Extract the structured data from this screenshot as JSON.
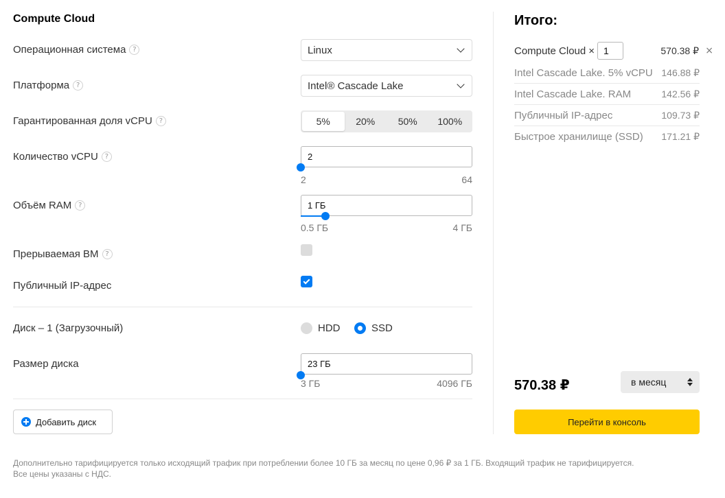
{
  "config": {
    "title": "Compute Cloud",
    "os": {
      "label": "Операционная система",
      "value": "Linux"
    },
    "platform": {
      "label": "Платформа",
      "value": "Intel® Cascade Lake"
    },
    "vcpu_share": {
      "label": "Гарантированная доля vCPU",
      "options": [
        "5%",
        "20%",
        "50%",
        "100%"
      ],
      "selected": "5%"
    },
    "vcpu_count": {
      "label": "Количество vCPU",
      "value": "2",
      "min": "2",
      "max": "64",
      "level": 0.0
    },
    "ram": {
      "label": "Объём RAM",
      "value": "1 ГБ",
      "min": "0.5 ГБ",
      "max": "4 ГБ",
      "level": 0.143
    },
    "preemptible": {
      "label": "Прерываемая ВМ",
      "checked": false
    },
    "public_ip": {
      "label": "Публичный IP-адрес",
      "checked": true
    },
    "disk": {
      "label": "Диск – 1 (Загрузочный)",
      "options": [
        "HDD",
        "SSD"
      ],
      "selected": "SSD"
    },
    "disk_size": {
      "label": "Размер диска",
      "value": "23 ГБ",
      "min": "3 ГБ",
      "max": "4096 ГБ",
      "level": 0.0
    },
    "add_disk_label": "Добавить диск",
    "help_glyph": "?"
  },
  "summary": {
    "title": "Итого:",
    "product": "Compute Cloud",
    "times": "×",
    "quantity": "1",
    "product_price": "570.38 ₽",
    "remove_glyph": "×",
    "items": [
      {
        "name": "Intel Cascade Lake. 5% vCPU",
        "price": "146.88 ₽"
      },
      {
        "name": "Intel Cascade Lake. RAM",
        "price": "142.56 ₽"
      },
      {
        "name": "Публичный IP-адрес",
        "price": "109.73 ₽"
      },
      {
        "name": "Быстрое хранилище (SSD)",
        "price": "171.21 ₽"
      }
    ],
    "total": "570.38 ₽",
    "period": "в месяц",
    "cta_label": "Перейти в консоль"
  },
  "footnote": {
    "line1": "Дополнительно тарифицируется только исходящий трафик при потреблении более 10 ГБ за месяц по цене 0,96 ₽ за 1 ГБ. Входящий трафик не тарифицируется.",
    "line2": "Все цены указаны с НДС."
  },
  "colors": {
    "accent": "#027bf3",
    "cta": "#ffcc00"
  }
}
